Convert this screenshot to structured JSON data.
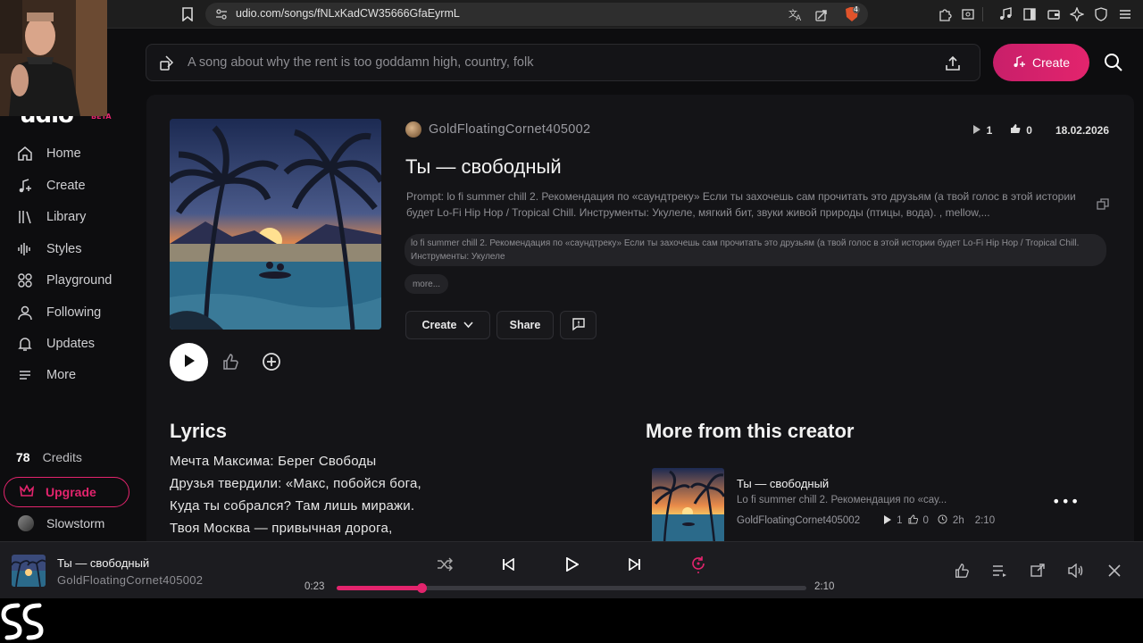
{
  "browser": {
    "url": "udio.com/songs/fNLxKadCW35666GfaEyrmL",
    "badge_count": "4"
  },
  "sidebar": {
    "logo": "udio",
    "beta": "BETA",
    "items": [
      {
        "label": "Home",
        "icon": "home-icon"
      },
      {
        "label": "Create",
        "icon": "music-note-plus-icon"
      },
      {
        "label": "Library",
        "icon": "library-icon"
      },
      {
        "label": "Styles",
        "icon": "waveform-icon"
      },
      {
        "label": "Playground",
        "icon": "playground-icon"
      },
      {
        "label": "Following",
        "icon": "person-icon"
      },
      {
        "label": "Updates",
        "icon": "bell-icon"
      },
      {
        "label": "More",
        "icon": "menu-icon"
      }
    ],
    "credits_count": "78",
    "credits_label": "Credits",
    "upgrade_label": "Upgrade",
    "username": "Slowstorm"
  },
  "topbar": {
    "search_placeholder": "A song about why the rent is too goddamn high, country, folk",
    "create_label": "Create"
  },
  "song": {
    "creator": "GoldFloatingCornet405002",
    "plays": "1",
    "likes": "0",
    "date": "18.02.2026",
    "title": "Ты — свободный",
    "prompt": "Prompt: lo fi summer chill 2. Рекомендация по «саундтреку» Если ты захочешь сам прочитать это друзьям (а твой голос в этой истории будет Lo-Fi Hip Hop / Tropical Chill. Инструменты: Укулеле, мягкий бит, звуки живой природы (птицы, вода). , mellow,...",
    "tags": "lo fi summer chill 2. Рекомендация по «саундтреку» Если ты захочешь сам прочитать это друзьям (а твой голос в этой истории будет Lo-Fi Hip Hop / Tropical Chill. Инструменты: Укулеле",
    "more_label": "more...",
    "create_label": "Create",
    "share_label": "Share"
  },
  "lyrics": {
    "heading": "Lyrics",
    "lines": [
      "Мечта Максима: Берег Свободы",
      "Друзья твердили: «Макс, побойся бога,",
      "Куда ты собрался? Там лишь миражи.",
      "Твоя Москва — привычная дорога,"
    ]
  },
  "more_from_creator": {
    "heading": "More from this creator",
    "items": [
      {
        "title": "Ты — свободный",
        "desc": "Lo fi summer chill 2. Рекомендация по «сау...",
        "creator": "GoldFloatingCornet405002",
        "plays": "1",
        "likes": "0",
        "age": "2h",
        "duration": "2:10"
      }
    ]
  },
  "player": {
    "title": "Ты — свободный",
    "artist": "GoldFloatingCornet405002",
    "elapsed": "0:23",
    "total": "2:10",
    "progress_fraction": 0.18
  },
  "colors": {
    "accent": "#e3246d",
    "background": "#0d0d0f",
    "card": "#141417"
  }
}
